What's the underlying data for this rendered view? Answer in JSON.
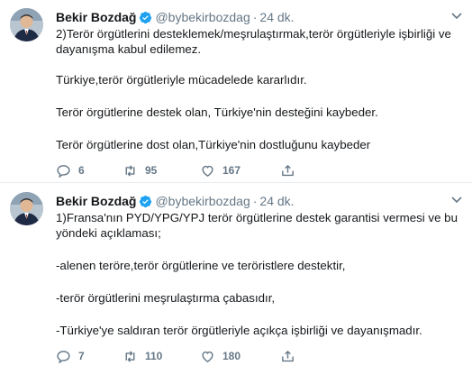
{
  "tweets": [
    {
      "author": "Bekir Bozdağ",
      "handle": "@bybekirbozdag",
      "separator": "·",
      "time": "24 dk.",
      "lines": [
        "2)Terör örgütlerini desteklemek/meşrulaştırmak,terör örgütleriyle işbirliği ve",
        "dayanışma kabul edilemez."
      ],
      "paragraphs": [
        "Türkiye,terör örgütleriyle mücadelede kararlıdır.",
        "Terör örgütlerine destek olan, Türkiye'nin desteğini kaybeder.",
        "Terör örgütlerine dost olan,Türkiye'nin dostluğunu kaybeder"
      ],
      "replies": "6",
      "retweets": "95",
      "likes": "167"
    },
    {
      "author": "Bekir Bozdağ",
      "handle": "@bybekirbozdag",
      "separator": "·",
      "time": "24 dk.",
      "lines": [
        "1)Fransa'nın PYD/YPG/YPJ terör örgütlerine destek garantisi vermesi ve bu",
        "yöndeki açıklaması;"
      ],
      "paragraphs": [
        "-alenen teröre,terör örgütlerine ve teröristlere destektir,",
        "-terör örgütlerini meşrulaştırma çabasıdır,",
        "-Türkiye'ye saldıran terör örgütleriyle açıkça işbirliği ve dayanışmadır."
      ],
      "replies": "7",
      "retweets": "110",
      "likes": "180"
    }
  ],
  "colors": {
    "verified": "#1da1f2",
    "muted": "#657786",
    "text": "#14171a",
    "divider": "#e6ecf0"
  },
  "icons": {
    "verified": "verified-badge-icon",
    "reply": "reply-icon",
    "retweet": "retweet-icon",
    "like": "heart-icon",
    "share": "share-icon",
    "menu": "chevron-down-icon"
  }
}
